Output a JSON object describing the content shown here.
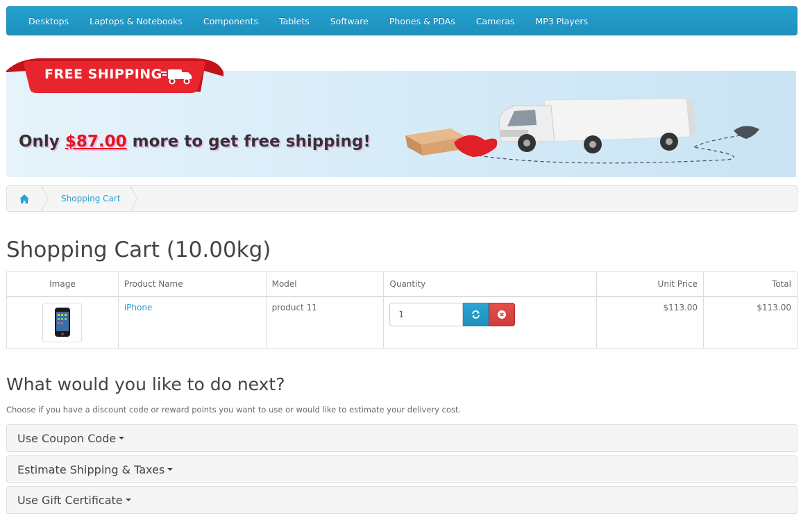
{
  "menu": {
    "items": [
      "Desktops",
      "Laptops & Notebooks",
      "Components",
      "Tablets",
      "Software",
      "Phones & PDAs",
      "Cameras",
      "MP3 Players"
    ]
  },
  "banner": {
    "ribbon_text": "FREE SHIPPING",
    "promo_prefix": "Only",
    "promo_amount": "$87.00",
    "promo_suffix": "more to get free shipping!"
  },
  "breadcrumb": {
    "home_icon": "home-icon",
    "current": "Shopping Cart"
  },
  "page": {
    "title": "Shopping Cart  (10.00kg)"
  },
  "cart_table": {
    "headers": {
      "image": "Image",
      "product_name": "Product Name",
      "model": "Model",
      "quantity": "Quantity",
      "unit_price": "Unit Price",
      "total": "Total"
    },
    "rows": [
      {
        "product_name": "iPhone",
        "model": "product 11",
        "quantity": "1",
        "unit_price": "$113.00",
        "total": "$113.00"
      }
    ]
  },
  "next_section": {
    "heading": "What would you like to do next?",
    "description": "Choose if you have a discount code or reward points you want to use or would like to estimate your delivery cost.",
    "panels": [
      "Use Coupon Code",
      "Estimate Shipping & Taxes",
      "Use Gift Certificate"
    ]
  },
  "colors": {
    "accent": "#23a1d1",
    "danger": "#d9534f",
    "promo_red": "#e8141d"
  }
}
